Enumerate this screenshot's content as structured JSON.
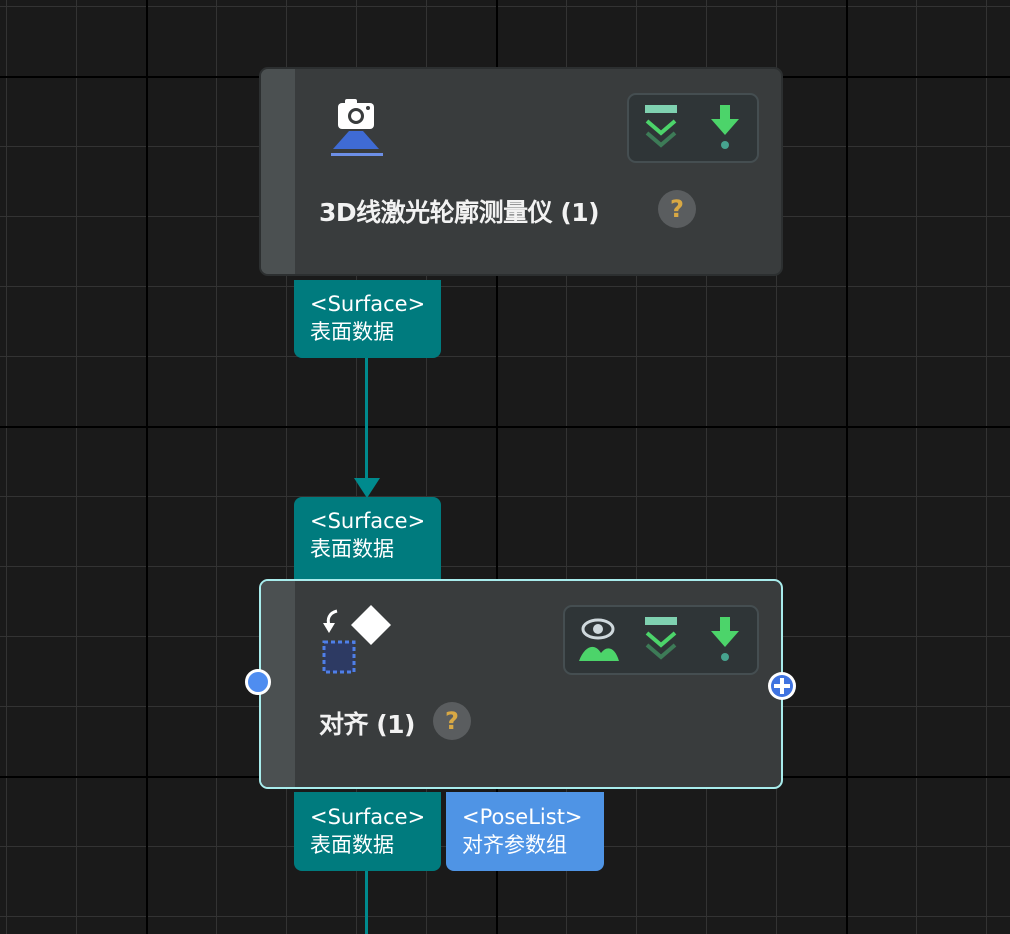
{
  "nodes": {
    "camera": {
      "title": "3D线激光轮廓测量仪 (1)",
      "help": "?",
      "icon": "laser-profiler-camera-icon",
      "tools": [
        "collapse-icon",
        "download-arrow-icon"
      ]
    },
    "align": {
      "title": "对齐 (1)",
      "help": "?",
      "icon": "align-transform-icon",
      "tools": [
        "visibility-eye-icon",
        "collapse-icon",
        "download-arrow-icon"
      ]
    }
  },
  "ports": {
    "camera_out": {
      "type": "<Surface>",
      "name": "表面数据"
    },
    "align_in": {
      "type": "<Surface>",
      "name": "表面数据"
    },
    "align_out_surface": {
      "type": "<Surface>",
      "name": "表面数据"
    },
    "align_out_poselist": {
      "type": "<PoseList>",
      "name": "对齐参数组"
    }
  },
  "colors": {
    "canvas_bg": "#1a1a1a",
    "node_bg": "#393c3d",
    "selected_border": "#a8ecec",
    "port_teal": "#007b7e",
    "port_blue": "#4f94e5",
    "icon_green": "#4cd46a",
    "help_question": "#d8a844",
    "input_dot": "#4f8df0"
  }
}
